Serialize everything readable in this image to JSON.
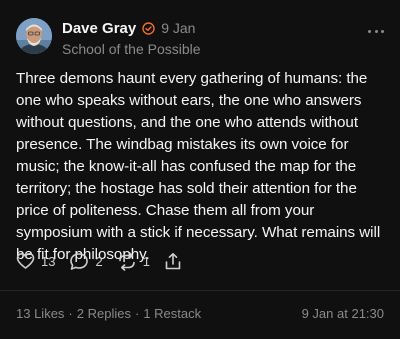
{
  "post": {
    "author": {
      "name": "Dave Gray",
      "subtitle": "School of the Possible",
      "avatar_icon": "avatar-photo",
      "verified_icon": "verified-badge-icon",
      "verified_color": "#f26b2a"
    },
    "date": "9 Jan",
    "text": "Three demons haunt every gathering of humans: the one who speaks without ears, the one who answers without questions, and the one who attends without presence. The windbag mistakes its own voice for music; the know-it-all has confused the map for the territory; the hostage has sold their attention for the price of politeness. Chase them all from your symposium with a stick if necessary. What remains will be fit for philosophy.",
    "actions": {
      "likes": {
        "icon": "heart-icon",
        "count": "13"
      },
      "replies": {
        "icon": "comment-icon",
        "count": "2"
      },
      "restacks": {
        "icon": "restack-icon",
        "count": "1"
      },
      "share": {
        "icon": "share-icon"
      }
    },
    "footer": {
      "likes": "13 Likes",
      "replies": "2 Replies",
      "restacks": "1 Restack",
      "separator": "·",
      "timestamp": "9 Jan at 21:30"
    },
    "colors": {
      "background": "#101010",
      "text": "#f3f5f7",
      "muted": "#8a8a8a"
    }
  }
}
